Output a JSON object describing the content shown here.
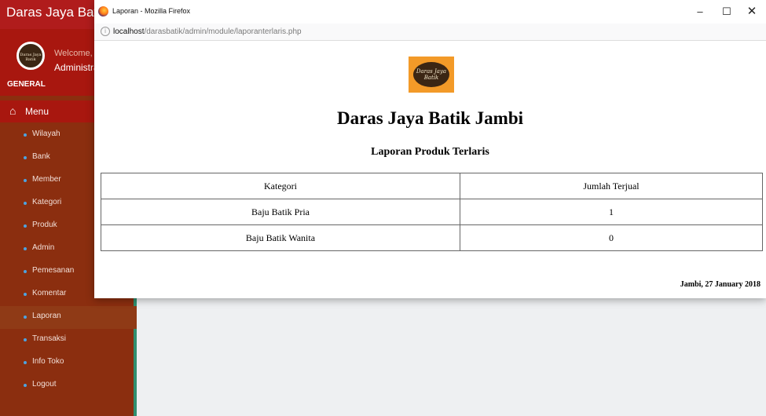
{
  "app": {
    "brand": "Daras Jaya Batik",
    "avatar_text": "Daras Jaya Batik",
    "welcome": "Welcome,",
    "user": "Administrator",
    "section": "GENERAL",
    "menu_label": "Menu",
    "menu_items": [
      {
        "label": "Wilayah"
      },
      {
        "label": "Bank"
      },
      {
        "label": "Member"
      },
      {
        "label": "Kategori"
      },
      {
        "label": "Produk"
      },
      {
        "label": "Admin"
      },
      {
        "label": "Pemesanan"
      },
      {
        "label": "Komentar"
      },
      {
        "label": "Laporan"
      },
      {
        "label": "Transaksi"
      },
      {
        "label": "Info Toko"
      },
      {
        "label": "Logout"
      }
    ],
    "active_item": "Laporan"
  },
  "popup": {
    "window_title": "Laporan - Mozilla Firefox",
    "url_host": "localhost",
    "url_path": "/darasbatik/admin/module/laporanterlaris.php",
    "logo_text": "Daras Jaya Batik",
    "report_title": "Daras Jaya Batik Jambi",
    "report_subtitle": "Laporan Produk Terlaris",
    "table": {
      "headers": [
        "Kategori",
        "Jumlah Terjual"
      ],
      "rows": [
        [
          "Baju Batik Pria",
          "1"
        ],
        [
          "Baju Batik Wanita",
          "0"
        ]
      ]
    },
    "date_line": "Jambi, 27 January 2018"
  },
  "icons": {
    "home": "home-icon",
    "browser": "firefox-icon",
    "site": "site-info-icon",
    "minimize": "minimize-icon",
    "maximize": "maximize-icon",
    "close": "close-icon"
  },
  "colors": {
    "sidebar": "#8b2e0f",
    "brand_bar": "#b01c1c",
    "accent": "#2f8f6f",
    "logo_bg": "#f39a28"
  }
}
